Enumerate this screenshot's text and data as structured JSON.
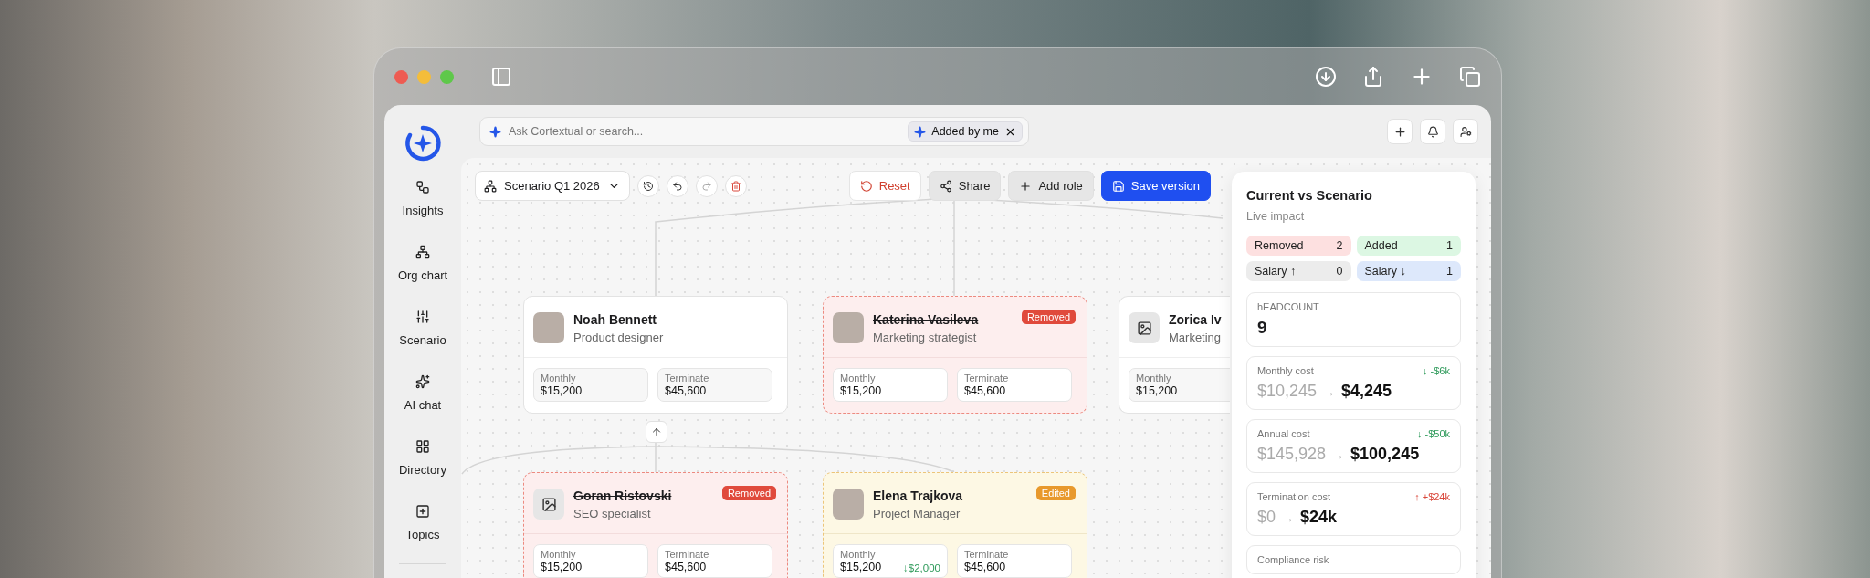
{
  "search": {
    "placeholder": "Ask Cortextual or search...",
    "chip": "Added by me"
  },
  "sidebar": {
    "items": [
      {
        "label": "Insights"
      },
      {
        "label": "Org chart"
      },
      {
        "label": "Scenario"
      },
      {
        "label": "AI chat"
      },
      {
        "label": "Directory"
      },
      {
        "label": "Topics"
      }
    ]
  },
  "toolbar": {
    "scenario": "Scenario Q1 2026",
    "buttons": [
      {
        "label": "Reset",
        "kind": "danger"
      },
      {
        "label": "Share",
        "kind": "secondary"
      },
      {
        "label": "Add role",
        "kind": "secondary"
      },
      {
        "label": "Save version",
        "kind": "primary"
      }
    ]
  },
  "org_chart": {
    "rows": [
      [
        {
          "name": "Noah Bennett",
          "role": "Product designer",
          "removed": false,
          "edited": false,
          "has_photo": true,
          "stats": [
            {
              "label": "Monthly",
              "value": "$15,200"
            },
            {
              "label": "Terminate",
              "value": "$45,600"
            }
          ]
        },
        {
          "name": "Katerina Vasileva",
          "role": "Marketing strategist",
          "removed": true,
          "edited": false,
          "badge": "Removed",
          "has_photo": true,
          "stats": [
            {
              "label": "Monthly",
              "value": "$15,200"
            },
            {
              "label": "Terminate",
              "value": "$45,600"
            }
          ]
        },
        {
          "name": "Zorica Iv",
          "role": "Marketing",
          "removed": false,
          "edited": false,
          "has_photo": false,
          "stats": [
            {
              "label": "Monthly",
              "value": "$15,200"
            }
          ]
        }
      ],
      [
        {
          "name": "Goran Ristovski",
          "role": "SEO specialist",
          "removed": true,
          "edited": false,
          "badge": "Removed",
          "has_photo": false,
          "stats": [
            {
              "label": "Monthly",
              "value": "$15,200"
            },
            {
              "label": "Terminate",
              "value": "$45,600"
            }
          ]
        },
        {
          "name": "Elena Trajkova",
          "role": "Project Manager",
          "removed": false,
          "edited": true,
          "badge": "Edited",
          "has_photo": true,
          "stats": [
            {
              "label": "Monthly",
              "value": "$15,200",
              "delta": "↓$2,000"
            },
            {
              "label": "Terminate",
              "value": "$45,600"
            }
          ]
        }
      ]
    ]
  },
  "impact": {
    "title": "Current vs Scenario",
    "subtitle": "Live impact",
    "chips": [
      {
        "label": "Removed",
        "count": "2",
        "color": "#fde0e0"
      },
      {
        "label": "Added",
        "count": "1",
        "color": "#dcf7e3"
      },
      {
        "label": "Salary ↑",
        "count": "0",
        "color": "#ececec"
      },
      {
        "label": "Salary ↓",
        "count": "1",
        "color": "#dde8fb"
      }
    ],
    "metrics": [
      {
        "kind": "single",
        "label": "hEADCOUNT",
        "value": "9"
      },
      {
        "kind": "change",
        "label": "Monthly cost",
        "before": "$10,245",
        "arrow": "→",
        "after": "$4,245",
        "delta": "↓ -$6k",
        "rising": false
      },
      {
        "kind": "change",
        "label": "Annual cost",
        "before": "$145,928",
        "arrow": "→",
        "after": "$100,245",
        "delta": "↓ -$50k",
        "rising": false
      },
      {
        "kind": "change",
        "label": "Termination cost",
        "before": "$0",
        "arrow": "→",
        "after": "$24k",
        "delta": "↑ +$24k",
        "rising": true
      },
      {
        "kind": "label",
        "label": "Compliance risk"
      }
    ]
  }
}
